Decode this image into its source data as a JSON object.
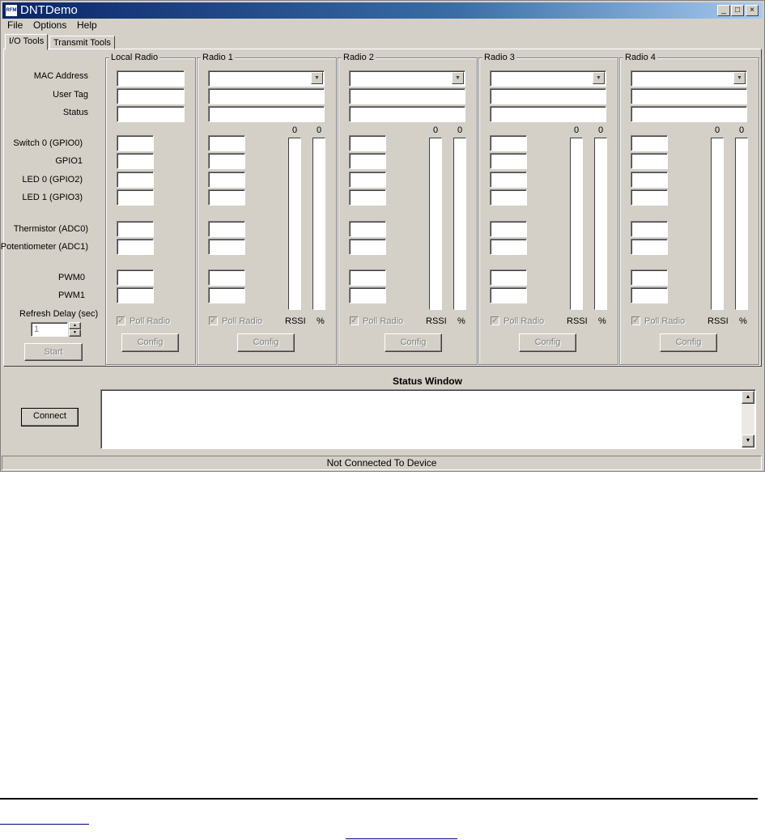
{
  "window": {
    "title": "DNTDemo",
    "icon_text": "RFM",
    "minimize": "_",
    "maximize": "□",
    "close": "×"
  },
  "menu": [
    {
      "label": "File"
    },
    {
      "label": "Options"
    },
    {
      "label": "Help"
    }
  ],
  "tabs": [
    {
      "label": "I/O Tools",
      "active": true
    },
    {
      "label": "Transmit Tools",
      "active": false
    }
  ],
  "row_labels": {
    "mac": "MAC Address",
    "user_tag": "User Tag",
    "status": "Status",
    "switch0": "Switch 0 (GPIO0)",
    "gpio1": "GPIO1",
    "led0": "LED 0 (GPIO2)",
    "led1": "LED 1 (GPIO3)",
    "thermistor": "Thermistor (ADC0)",
    "potentiometer": "Potentiometer (ADC1)",
    "pwm0": "PWM0",
    "pwm1": "PWM1"
  },
  "refresh": {
    "label": "Refresh Delay (sec)",
    "value": "1",
    "start_label": "Start"
  },
  "groups": [
    {
      "title": "Local Radio",
      "poll_label": "Poll Radio",
      "config_label": "Config"
    },
    {
      "title": "Radio 1",
      "poll_label": "Poll Radio",
      "config_label": "Config",
      "rssi_value": "0",
      "pct_value": "0",
      "rssi_label": "RSSI",
      "pct_label": "%"
    },
    {
      "title": "Radio 2",
      "poll_label": "Poll Radio",
      "config_label": "Config",
      "rssi_value": "0",
      "pct_value": "0",
      "rssi_label": "RSSI",
      "pct_label": "%"
    },
    {
      "title": "Radio 3",
      "poll_label": "Poll Radio",
      "config_label": "Config",
      "rssi_value": "0",
      "pct_value": "0",
      "rssi_label": "RSSI",
      "pct_label": "%"
    },
    {
      "title": "Radio 4",
      "poll_label": "Poll Radio",
      "config_label": "Config",
      "rssi_value": "0",
      "pct_value": "0",
      "rssi_label": "RSSI",
      "pct_label": "%"
    }
  ],
  "connect_label": "Connect",
  "status_window_title": "Status Window",
  "statusbar_text": "Not Connected To Device",
  "icons": {
    "scroll_up": "▲",
    "scroll_down": "▼",
    "combo": "▼",
    "check": "✓",
    "spin_up": "▲",
    "spin_down": "▼"
  }
}
